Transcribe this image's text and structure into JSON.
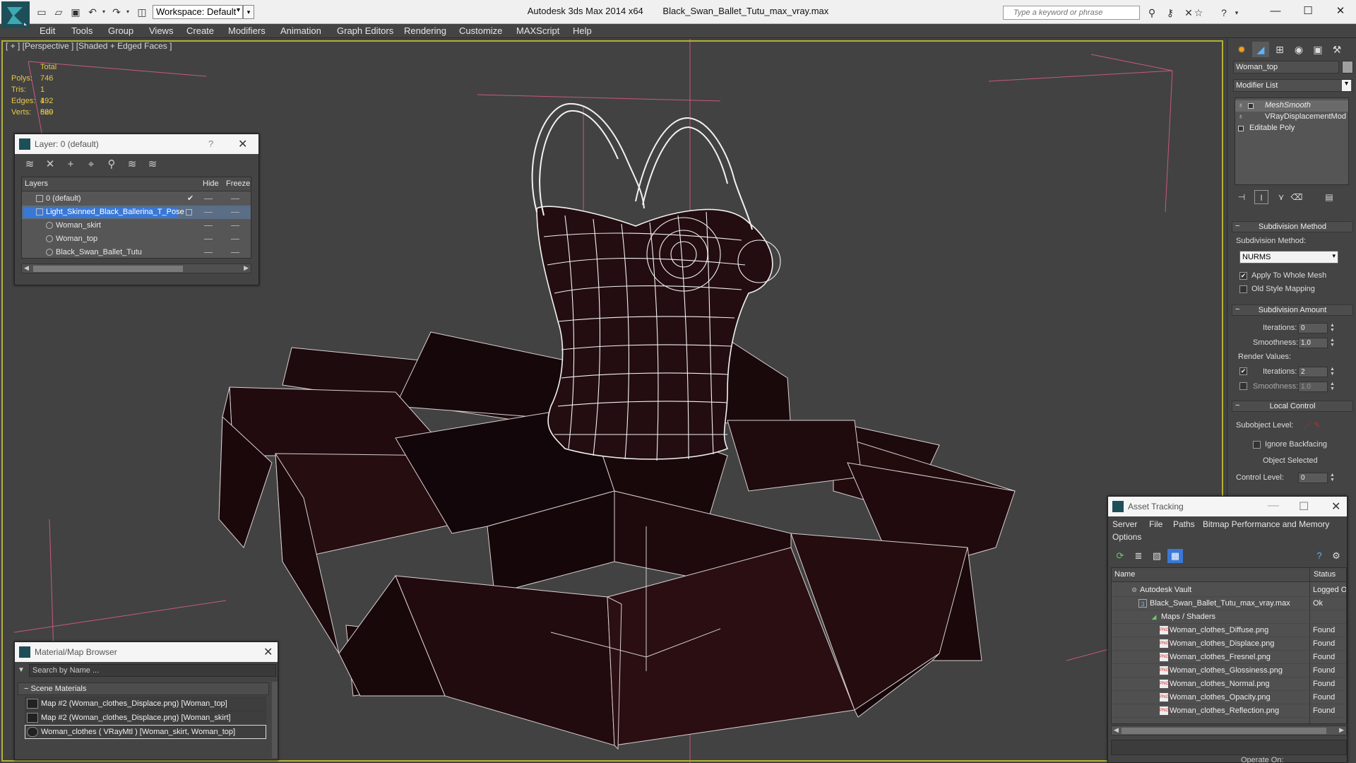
{
  "titlebar": {
    "workspace_label": "Workspace: Default",
    "app_title": "Autodesk 3ds Max  2014 x64",
    "file_title": "Black_Swan_Ballet_Tutu_max_vray.max",
    "search_placeholder": "Type a keyword or phrase"
  },
  "menu": [
    "Edit",
    "Tools",
    "Group",
    "Views",
    "Create",
    "Modifiers",
    "Animation",
    "Graph Editors",
    "Rendering",
    "Customize",
    "MAXScript",
    "Help"
  ],
  "viewport": {
    "label": "[ + ] [Perspective ] [Shaded + Edged Faces ]",
    "stats": {
      "header": "Total",
      "rows": [
        {
          "k": "Polys:",
          "v": "746"
        },
        {
          "k": "Tris:",
          "v": "1 492"
        },
        {
          "k": "Edges:",
          "v": "1 569"
        },
        {
          "k": "Verts:",
          "v": "820"
        }
      ]
    },
    "colors": {
      "background": "#424242",
      "wire": "#f2f2f2",
      "fabric": "#1c0a0c",
      "grid": "#c75a7a",
      "border": "#b5b03a"
    }
  },
  "layer_dialog": {
    "title": "Layer: 0 (default)",
    "help": "?",
    "columns": {
      "layers": "Layers",
      "hide": "Hide",
      "freeze": "Freeze"
    },
    "rows": [
      {
        "name": "0 (default)"
      },
      {
        "name": "Light_Skinned_Black_Ballerina_T_Pose"
      },
      {
        "name": "Woman_skirt"
      },
      {
        "name": "Woman_top"
      },
      {
        "name": "Black_Swan_Ballet_Tutu"
      }
    ]
  },
  "material_browser": {
    "title": "Material/Map Browser",
    "search_placeholder": "Search by Name ...",
    "section": "Scene Materials",
    "items": [
      "Map #2 (Woman_clothes_Displace.png) [Woman_top]",
      "Map #2 (Woman_clothes_Displace.png) [Woman_skirt]",
      "Woman_clothes  ( VRayMtl ) [Woman_skirt, Woman_top]"
    ]
  },
  "command_panel": {
    "object_name": "Woman_top",
    "modifier_list": "Modifier List",
    "stack": [
      "MeshSmooth",
      "VRayDisplacementMod",
      "Editable Poly"
    ],
    "subdivision_method": {
      "title": "Subdivision Method",
      "label": "Subdivision Method:",
      "value": "NURMS",
      "apply_whole": "Apply To Whole Mesh",
      "old_style": "Old Style Mapping"
    },
    "subdivision_amount": {
      "title": "Subdivision Amount",
      "iterations_label": "Iterations:",
      "iterations": "0",
      "smoothness_label": "Smoothness:",
      "smoothness": "1.0",
      "render_values": "Render Values:",
      "render_iterations": "2",
      "render_smoothness": "1.0"
    },
    "local_control": {
      "title": "Local Control",
      "subobject_level": "Subobject Level:",
      "ignore_backfacing": "Ignore Backfacing",
      "object_selected": "Object Selected",
      "control_level_label": "Control Level:",
      "control_level": "0"
    },
    "operate_on": "Operate On:"
  },
  "asset_tracking": {
    "title": "Asset Tracking",
    "menu": [
      "Server",
      "File",
      "Paths",
      "Bitmap Performance and Memory",
      "Options"
    ],
    "columns": {
      "name": "Name",
      "status": "Status"
    },
    "rows": [
      {
        "name": "Autodesk Vault",
        "status": "Logged O"
      },
      {
        "name": "Black_Swan_Ballet_Tutu_max_vray.max",
        "status": "Ok"
      },
      {
        "name": "Maps / Shaders",
        "status": ""
      },
      {
        "name": "Woman_clothes_Diffuse.png",
        "status": "Found"
      },
      {
        "name": "Woman_clothes_Displace.png",
        "status": "Found"
      },
      {
        "name": "Woman_clothes_Fresnel.png",
        "status": "Found"
      },
      {
        "name": "Woman_clothes_Glossiness.png",
        "status": "Found"
      },
      {
        "name": "Woman_clothes_Normal.png",
        "status": "Found"
      },
      {
        "name": "Woman_clothes_Opacity.png",
        "status": "Found"
      },
      {
        "name": "Woman_clothes_Reflection.png",
        "status": "Found"
      }
    ]
  }
}
